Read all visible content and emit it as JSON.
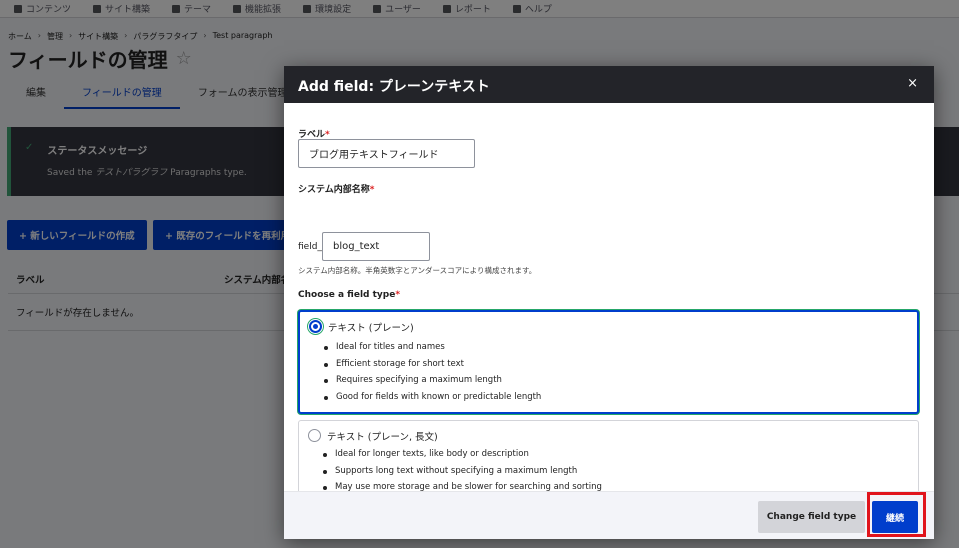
{
  "toolbar": {
    "items": [
      {
        "label": "コンテンツ",
        "icon": "document-icon"
      },
      {
        "label": "サイト構築",
        "icon": "structure-icon"
      },
      {
        "label": "テーマ",
        "icon": "brush-icon"
      },
      {
        "label": "機能拡張",
        "icon": "puzzle-icon"
      },
      {
        "label": "環境設定",
        "icon": "wrench-icon"
      },
      {
        "label": "ユーザー",
        "icon": "people-icon"
      },
      {
        "label": "レポート",
        "icon": "chart-icon"
      },
      {
        "label": "ヘルプ",
        "icon": "help-icon"
      }
    ]
  },
  "breadcrumb": [
    "ホーム",
    "管理",
    "サイト構築",
    "パラグラフタイプ",
    "Test paragraph"
  ],
  "breadcrumb_sep": "›",
  "page": {
    "title": "フィールドの管理",
    "star": "☆"
  },
  "tabs": [
    "編集",
    "フィールドの管理",
    "フォームの表示管理"
  ],
  "status": {
    "check": "✓",
    "title": "ステータスメッセージ",
    "message_prefix": "Saved the ",
    "message_em": "テストパラグラフ",
    "message_suffix": " Paragraphs type."
  },
  "actions": {
    "create_field": "+ 新しいフィールドの作成",
    "reuse_field": "+ 既存のフィールドを再利用"
  },
  "table": {
    "col_label": "ラベル",
    "col_machine": "システム内部名",
    "empty": "フィールドが存在しません。"
  },
  "modal": {
    "title": "Add field: プレーンテキスト",
    "close": "×",
    "label_field": {
      "label": "ラベル",
      "required": "*",
      "value": "ブログ用テキストフィールド"
    },
    "machine_field": {
      "label": "システム内部名称",
      "required": "*",
      "prefix": "field_",
      "value": "blog_text",
      "description": "システム内部名称。半角英数字とアンダースコアにより構成されます。"
    },
    "field_type": {
      "label": "Choose a field type",
      "required": "*",
      "options": [
        {
          "title": "テキスト (プレーン)",
          "selected": true,
          "bullets": [
            "Ideal for titles and names",
            "Efficient storage for short text",
            "Requires specifying a maximum length",
            "Good for fields with known or predictable length"
          ]
        },
        {
          "title": "テキスト (プレーン, 長文)",
          "selected": false,
          "bullets": [
            "Ideal for longer texts, like body or description",
            "Supports long text without specifying a maximum length",
            "May use more storage and be slower for searching and sorting"
          ]
        }
      ]
    },
    "footer": {
      "change_type": "Change field type",
      "continue": "継続"
    }
  },
  "colors": {
    "primary": "#003ecc",
    "header_dark": "#232429",
    "required": "#dc2323",
    "highlight": "#e0141c",
    "status_bg": "#353641",
    "focus_green": "#26a769"
  }
}
